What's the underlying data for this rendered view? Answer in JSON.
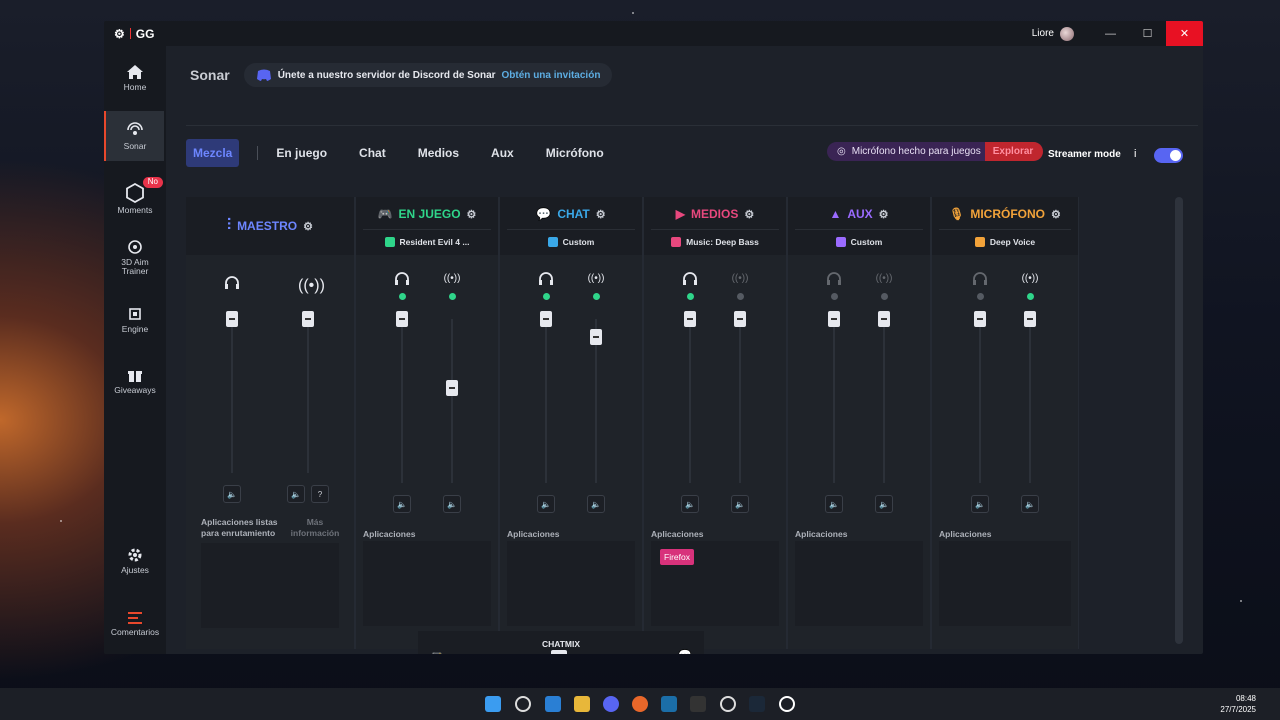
{
  "window": {
    "brand": "GG",
    "user": "Liore",
    "minimize": "—",
    "maximize": "☐",
    "close": "✕"
  },
  "sidebar": {
    "items": [
      {
        "label": "Home",
        "icon": "home-icon"
      },
      {
        "label": "Sonar",
        "icon": "sonar-icon",
        "active": true
      },
      {
        "label": "Moments",
        "icon": "moments-icon",
        "badge": "No"
      },
      {
        "label": "3D Aim Trainer",
        "icon": "aim-trainer-icon"
      },
      {
        "label": "Engine",
        "icon": "engine-icon"
      },
      {
        "label": "Giveaways",
        "icon": "gift-icon"
      },
      {
        "label": "Ajustes",
        "icon": "gear-icon"
      },
      {
        "label": "Comentarios",
        "icon": "feedback-icon"
      }
    ]
  },
  "header": {
    "title": "Sonar",
    "discord_text": "Únete a nuestro servidor de Discord de Sonar",
    "discord_link": "Obtén una invitación"
  },
  "tabs": [
    "Mezcla",
    "En juego",
    "Chat",
    "Medios",
    "Aux",
    "Micrófono"
  ],
  "promo": {
    "text": "Micrófono hecho para juegos",
    "action": "Explorar"
  },
  "streamer": {
    "label": "Streamer mode",
    "info": "i",
    "enabled": true
  },
  "channels": [
    {
      "name": "MAESTRO",
      "color": "#6d86ff",
      "preset": ""
    },
    {
      "name": "EN JUEGO",
      "color": "#2fd58a",
      "preset": "Resident Evil 4 ..."
    },
    {
      "name": "CHAT",
      "color": "#3aa8e8",
      "preset": "Custom"
    },
    {
      "name": "MEDIOS",
      "color": "#e8487e",
      "preset": "Music: Deep Bass"
    },
    {
      "name": "AUX",
      "color": "#9b6bff",
      "preset": "Custom"
    },
    {
      "name": "MICRÓFONO",
      "color": "#f2a33a",
      "preset": "Deep Voice"
    }
  ],
  "master": {
    "apps_label": "Aplicaciones listas para enrutamiento",
    "more_info": "Más información"
  },
  "apps_label": "Aplicaciones",
  "media_app": "Firefox",
  "chatmix": {
    "label": "CHATMIX",
    "value": 0.5
  },
  "levels": {
    "master": [
      1,
      1
    ],
    "game": [
      1,
      0.58
    ],
    "chat": [
      1,
      0.89
    ],
    "media": [
      1,
      1
    ],
    "aux": [
      1,
      1
    ],
    "mic": [
      1,
      1
    ]
  },
  "clock": {
    "time": "08:48",
    "date": "27/7/2025"
  }
}
